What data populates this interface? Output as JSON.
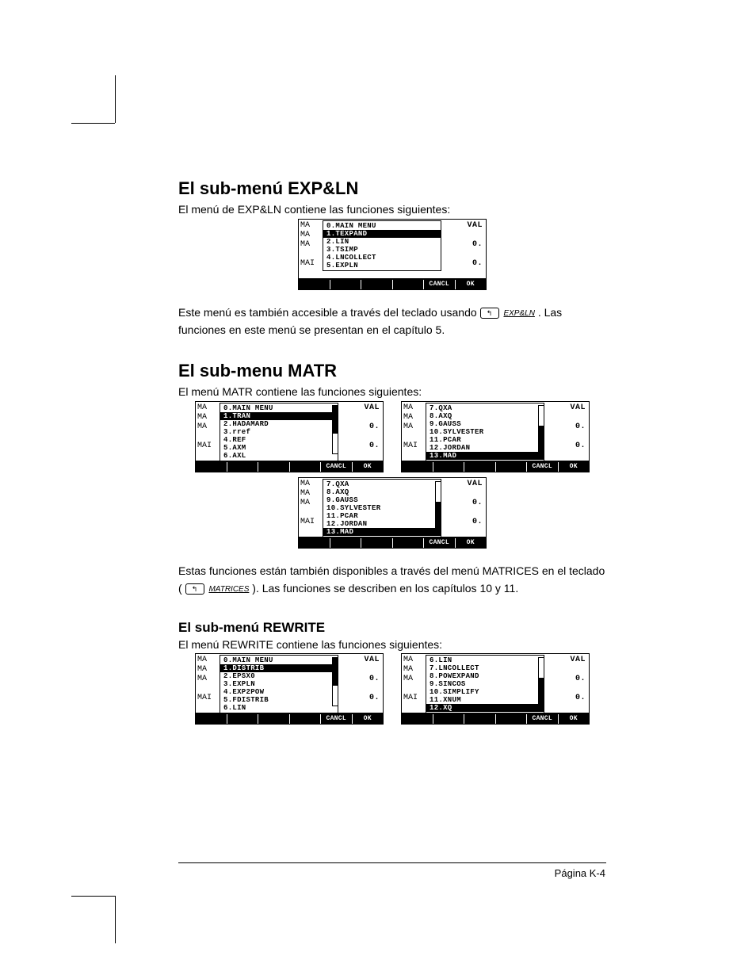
{
  "sections": {
    "expln": {
      "heading": "El sub-menú EXP&LN",
      "intro": "El menú de EXP&LN contiene las funciones siguientes:",
      "after_pre": "Este menú es también accesible a través del teclado usando ",
      "key_left": "↰",
      "key_label": "EXP&LN",
      "after_post": ".  Las funciones en este menú se presentan en el capítulo 5."
    },
    "matr": {
      "heading": "El sub-menu MATR",
      "intro": "El menú MATR contiene las funciones siguientes:",
      "after_pre": "Estas funciones están también disponibles a través del menú MATRICES en el teclado (",
      "key_left": "↰",
      "key_label": "MATRICES",
      "after_post": ").  Las funciones se describen en los capítulos 10 y 11."
    },
    "rewrite": {
      "heading": "El sub-menú REWRITE",
      "intro": "El menú REWRITE contiene las funciones siguientes:"
    }
  },
  "screens": {
    "leftlabels": [
      "MA",
      "MA",
      "MA",
      "MAI"
    ],
    "rightvals": [
      "VAL",
      "",
      "0.",
      "",
      "0."
    ],
    "softkeys_blank": "",
    "softkeys_cancl": "CANCL",
    "softkeys_ok": "OK",
    "expln_menu": [
      {
        "t": "0.MAIN MENU",
        "sel": false
      },
      {
        "t": "1.TEXPAND",
        "sel": true
      },
      {
        "t": "2.LIN",
        "sel": false
      },
      {
        "t": "3.TSIMP",
        "sel": false
      },
      {
        "t": "4.LNCOLLECT",
        "sel": false
      },
      {
        "t": "5.EXPLN",
        "sel": false
      }
    ],
    "matr_menu_a": [
      {
        "t": "0.MAIN MENU",
        "sel": false
      },
      {
        "t": "1.TRAN",
        "sel": true
      },
      {
        "t": "2.HADAMARD",
        "sel": false
      },
      {
        "t": "3.rref",
        "sel": false
      },
      {
        "t": "4.REF",
        "sel": false
      },
      {
        "t": "5.AXM",
        "sel": false
      },
      {
        "t": "6.AXL",
        "sel": false
      }
    ],
    "matr_menu_b": [
      {
        "t": "7.QXA",
        "sel": false
      },
      {
        "t": "8.AXQ",
        "sel": false
      },
      {
        "t": "9.GAUSS",
        "sel": false
      },
      {
        "t": "10.SYLVESTER",
        "sel": false
      },
      {
        "t": "11.PCAR",
        "sel": false
      },
      {
        "t": "12.JORDAN",
        "sel": false
      },
      {
        "t": "13.MAD",
        "sel": true
      }
    ],
    "matr_menu_c": [
      {
        "t": "7.QXA",
        "sel": false
      },
      {
        "t": "8.AXQ",
        "sel": false
      },
      {
        "t": "9.GAUSS",
        "sel": false
      },
      {
        "t": "10.SYLVESTER",
        "sel": false
      },
      {
        "t": "11.PCAR",
        "sel": false
      },
      {
        "t": "12.JORDAN",
        "sel": false
      },
      {
        "t": "13.MAD",
        "sel": true
      }
    ],
    "rewrite_menu_a": [
      {
        "t": "0.MAIN MENU",
        "sel": false
      },
      {
        "t": "1.DISTRIB",
        "sel": true
      },
      {
        "t": "2.EPSX0",
        "sel": false
      },
      {
        "t": "3.EXPLN",
        "sel": false
      },
      {
        "t": "4.EXP2POW",
        "sel": false
      },
      {
        "t": "5.FDISTRIB",
        "sel": false
      },
      {
        "t": "6.LIN",
        "sel": false
      }
    ],
    "rewrite_menu_b": [
      {
        "t": "6.LIN",
        "sel": false
      },
      {
        "t": "7.LNCOLLECT",
        "sel": false
      },
      {
        "t": "8.POWEXPAND",
        "sel": false
      },
      {
        "t": "9.SINCOS",
        "sel": false
      },
      {
        "t": "10.SIMPLIFY",
        "sel": false
      },
      {
        "t": "11.XNUM",
        "sel": false
      },
      {
        "t": "12.XQ",
        "sel": true
      }
    ]
  },
  "footer": {
    "page": "Página K-4"
  }
}
